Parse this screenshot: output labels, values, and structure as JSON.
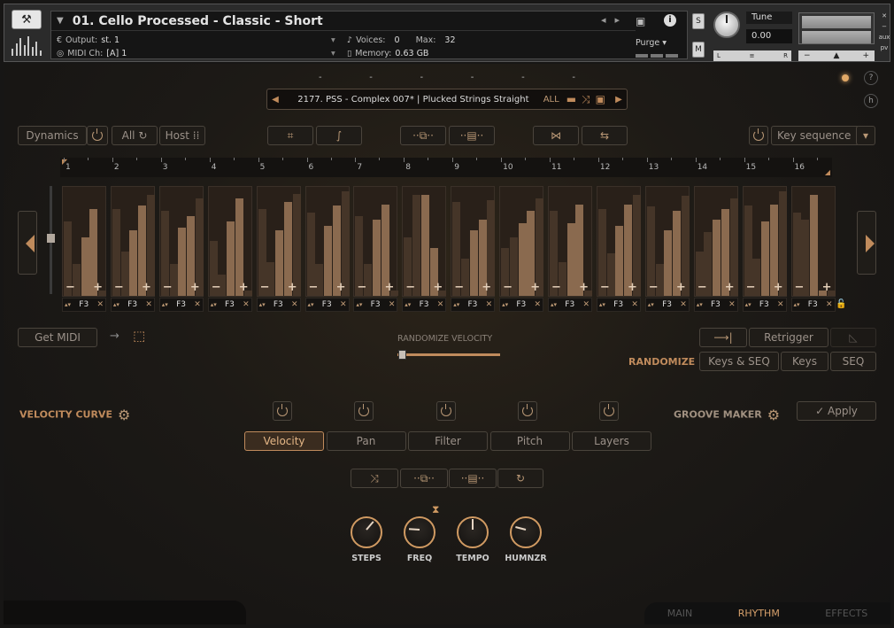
{
  "header": {
    "instrument_name": "01. Cello Processed - Classic - Short",
    "output_label": "Output:",
    "output_value": "st. 1",
    "midi_label": "MIDI Ch:",
    "midi_value": "[A] 1",
    "voices_label": "Voices:",
    "voices_value": "0",
    "max_label": "Max:",
    "max_value": "32",
    "memory_label": "Memory:",
    "memory_value": "0.63 GB",
    "purge_label": "Purge",
    "s_label": "S",
    "m_label": "M",
    "tune_label": "Tune",
    "tune_value": "0.00",
    "pan_left": "L",
    "pan_center": "≡",
    "pan_right": "R",
    "vol_minus": "−",
    "vol_plus": "+",
    "side_close": "✕",
    "side_min": "−",
    "side_aux": "aux",
    "side_pv": "pv",
    "info_label": "i"
  },
  "preset": {
    "name": "2177. PSS - Complex 007*",
    "separator": "|",
    "articulation": "Plucked Strings Straight",
    "all_label": "ALL",
    "dashes": [
      "-",
      "-",
      "-",
      "-",
      "-",
      "-"
    ]
  },
  "toolbar": {
    "dynamics_label": "Dynamics",
    "all_label": "All",
    "host_label": "Host",
    "key_sequence_label": "Key sequence"
  },
  "ruler": {
    "numbers": [
      "1",
      "2",
      "3",
      "4",
      "5",
      "6",
      "7",
      "8",
      "9",
      "10",
      "11",
      "12",
      "13",
      "14",
      "15",
      "16"
    ]
  },
  "steps": {
    "minus": "−",
    "plus": "+",
    "note_label": "F3",
    "note_arrows": "▴▾",
    "close": "✕",
    "levels": [
      [
        0.7,
        0.3,
        0.55,
        0.82,
        0.05
      ],
      [
        0.82,
        0.42,
        0.62,
        0.85,
        0.95
      ],
      [
        0.8,
        0.3,
        0.64,
        0.75,
        0.92
      ],
      [
        0.52,
        0.2,
        0.7,
        0.92,
        0.05
      ],
      [
        0.82,
        0.32,
        0.62,
        0.88,
        0.96
      ],
      [
        0.78,
        0.3,
        0.66,
        0.85,
        0.98
      ],
      [
        0.75,
        0.3,
        0.72,
        0.86,
        0.05
      ],
      [
        0.55,
        0.95,
        0.95,
        0.45,
        0.05
      ],
      [
        0.88,
        0.35,
        0.62,
        0.72,
        0.9
      ],
      [
        0.45,
        0.55,
        0.68,
        0.8,
        0.92
      ],
      [
        0.8,
        0.32,
        0.68,
        0.86,
        0.05
      ],
      [
        0.82,
        0.4,
        0.66,
        0.86,
        0.95
      ],
      [
        0.84,
        0.3,
        0.62,
        0.8,
        0.94
      ],
      [
        0.42,
        0.6,
        0.72,
        0.82,
        0.92
      ],
      [
        0.85,
        0.35,
        0.7,
        0.86,
        0.98
      ],
      [
        0.78,
        0.72,
        0.95,
        0.05,
        0.05
      ]
    ]
  },
  "middle": {
    "get_midi_label": "Get MIDI",
    "randomize_velocity_label": "RANDOMIZE VELOCITY",
    "retrigger_label": "Retrigger",
    "randomize_label": "RANDOMIZE",
    "keys_seq_label": "Keys & SEQ",
    "keys_label": "Keys",
    "seq_label": "SEQ"
  },
  "lower": {
    "velocity_curve_label": "VELOCITY CURVE",
    "groove_maker_label": "GROOVE MAKER",
    "apply_label": "Apply",
    "tabs": [
      {
        "label": "Velocity",
        "active": true
      },
      {
        "label": "Pan",
        "active": false
      },
      {
        "label": "Filter",
        "active": false
      },
      {
        "label": "Pitch",
        "active": false
      },
      {
        "label": "Layers",
        "active": false
      }
    ],
    "knobs": [
      {
        "label": "STEPS",
        "value": 0.65
      },
      {
        "label": "FREQ",
        "value": 0.18
      },
      {
        "label": "TEMPO",
        "value": 0.5
      },
      {
        "label": "HUMNZR",
        "value": 0.22
      }
    ]
  },
  "footer": {
    "tabs": [
      {
        "label": "MAIN",
        "active": false
      },
      {
        "label": "RHYTHM",
        "active": true
      },
      {
        "label": "EFFECTS",
        "active": false
      }
    ]
  },
  "misc": {
    "help_label": "?",
    "h_label": "h"
  },
  "colors": {
    "accent": "#c08b5c",
    "bar_active": "#8a6a4f",
    "bar_dim": "#453528"
  }
}
